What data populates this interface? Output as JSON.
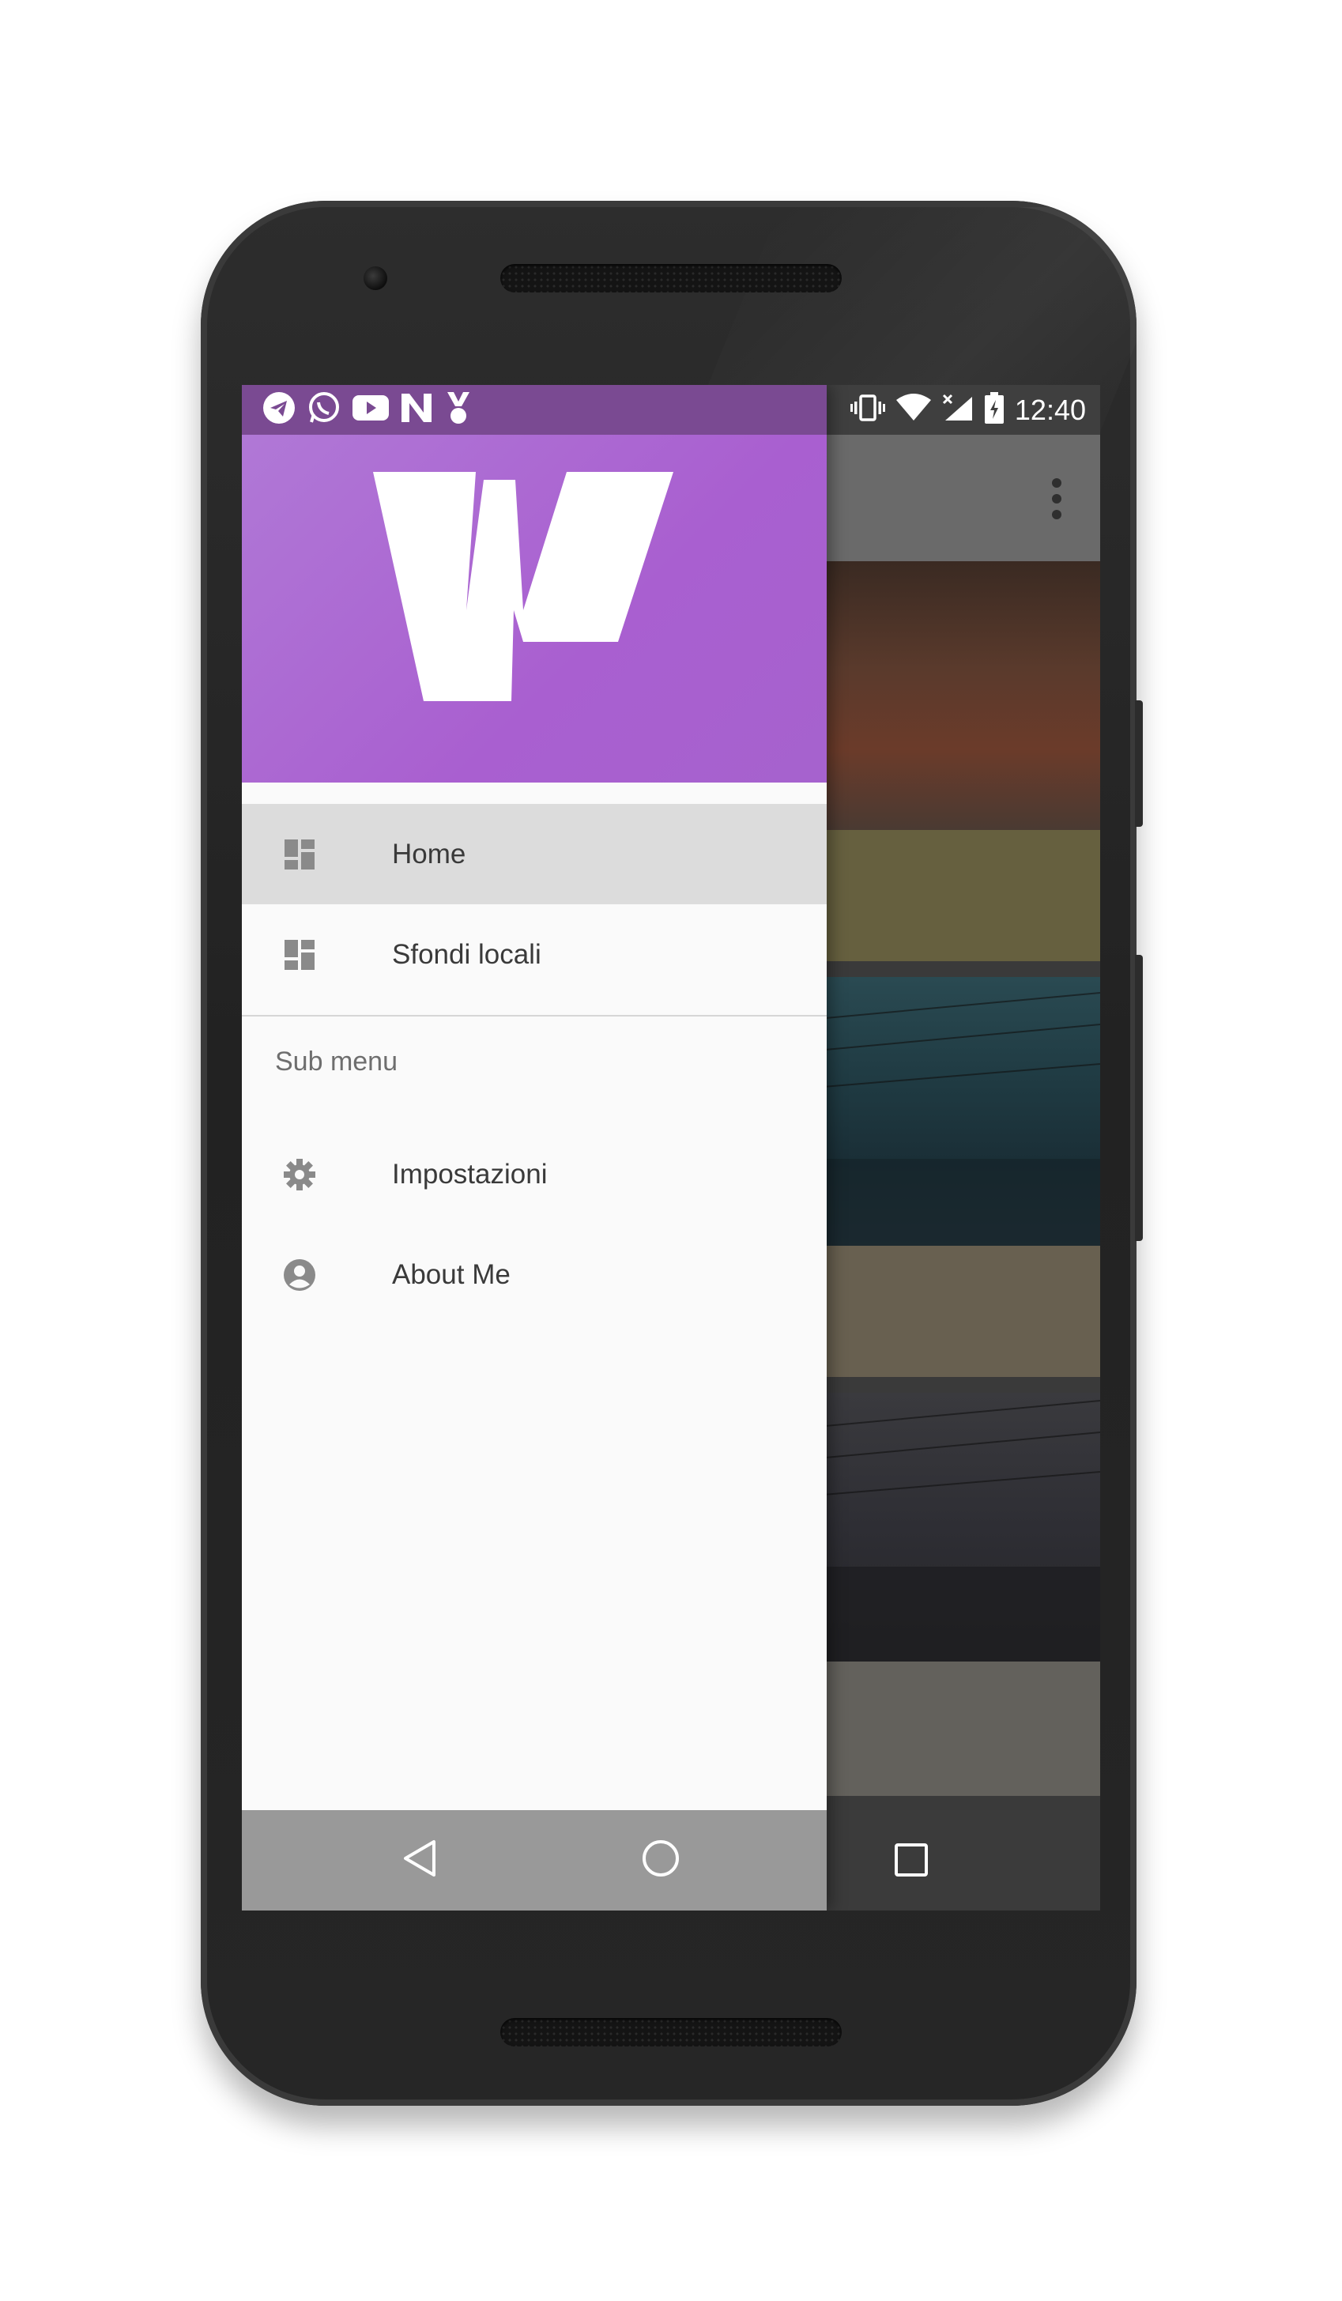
{
  "status_bar": {
    "time": "12:40",
    "notification_icons": [
      "telegram-icon",
      "whatsapp-icon",
      "youtube-icon",
      "n-app-icon",
      "medal-icon"
    ],
    "system_icons": [
      "vibrate-icon",
      "wifi-icon",
      "signal-no-data-icon",
      "battery-charging-icon"
    ]
  },
  "drawer": {
    "header_logo": "W",
    "items": [
      {
        "label": "Home",
        "icon": "dashboard-icon",
        "active": true
      },
      {
        "label": "Sfondi locali",
        "icon": "dashboard-icon",
        "active": false
      }
    ],
    "subheader": "Sub menu",
    "sub_items": [
      {
        "label": "Impostazioni",
        "icon": "gear-icon"
      },
      {
        "label": "About Me",
        "icon": "account-circle-icon"
      }
    ]
  },
  "navigation_bar": {
    "buttons": [
      "back-icon",
      "home-icon",
      "recents-icon"
    ]
  },
  "colors": {
    "drawer_header": "#a95fd0",
    "drawer_status_bar": "#7a4a92",
    "active_item_bg": "#dcdcdc"
  }
}
